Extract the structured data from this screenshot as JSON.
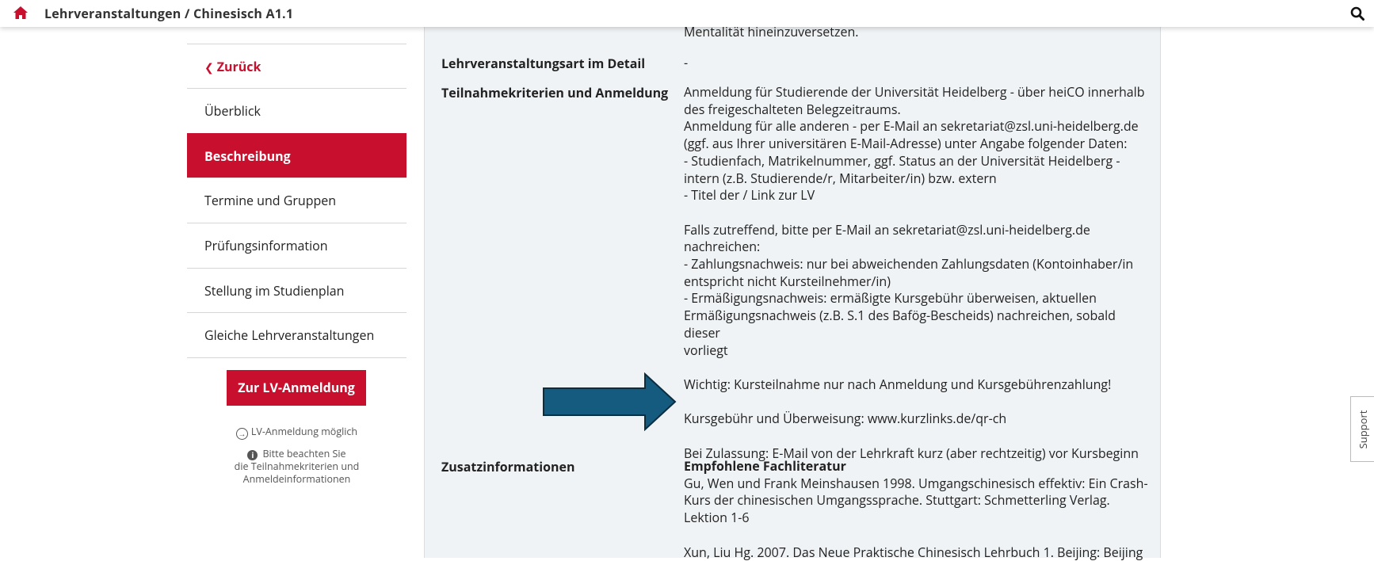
{
  "header": {
    "breadcrumb": "Lehrveranstaltungen / Chinesisch A1.1",
    "home_icon": "home-icon",
    "search_icon": "search-icon",
    "accent": "#c8102e"
  },
  "sidebar": {
    "back_label": "Zurück",
    "items": [
      {
        "label": "Überblick"
      },
      {
        "label": "Beschreibung",
        "active": true
      },
      {
        "label": "Termine und Gruppen"
      },
      {
        "label": "Prüfungsinformation"
      },
      {
        "label": "Stellung im Studienplan"
      },
      {
        "label": "Gleiche Lehrveranstaltungen"
      }
    ],
    "register_button": "Zur LV-Anmeldung",
    "hint_possible": "LV-Anmeldung möglich",
    "hint_note_lines": [
      "Bitte beachten Sie",
      "die Teilnahmekriterien und",
      "Anmeldeinformationen"
    ]
  },
  "content": {
    "cut_text": "Mentalität hineinzuversetzen.",
    "rows": [
      {
        "label": "Lehrveranstaltungsart im Detail",
        "value": "-"
      },
      {
        "label": "Teilnahmekriterien und Anmeldung",
        "lines": [
          "Anmeldung für Studierende der Universität Heidelberg - über heiCO innerhalb",
          "des freigeschalteten Belegzeitraums.",
          "Anmeldung für alle anderen - per E-Mail an sekretariat@zsl.uni-heidelberg.de",
          "(ggf. aus Ihrer universitären E-Mail-Adresse) unter Angabe folgender Daten:",
          "- Studienfach, Matrikelnummer, ggf. Status an der Universität Heidelberg -",
          "intern (z.B. Studierende/r, Mitarbeiter/in) bzw. extern",
          "- Titel der / Link zur LV",
          "",
          "Falls zutreffend, bitte per E-Mail an sekretariat@zsl.uni-heidelberg.de",
          "nachreichen:",
          "- Zahlungsnachweis: nur bei abweichenden Zahlungsdaten (Kontoinhaber/in",
          "entspricht nicht Kursteilnehmer/in)",
          "- Ermäßigungsnachweis: ermäßigte Kursgebühr überweisen, aktuellen",
          "Ermäßigungsnachweis (z.B. S.1 des Bafög-Bescheids) nachreichen, sobald dieser",
          "vorliegt",
          "",
          "Wichtig: Kursteilnahme nur nach Anmeldung und Kursgebührenzahlung!",
          "",
          "Kursgebühr und Überweisung: www.kurzlinks.de/qr-ch",
          "",
          "Bei Zulassung: E-Mail von der Lehrkraft kurz (aber rechtzeitig) vor Kursbeginn"
        ]
      },
      {
        "label": "Zusatzinformationen",
        "heading": "Empfohlene Fachliteratur",
        "lines": [
          "Gu, Wen und Frank Meinshausen 1998. Umgangschinesisch effektiv: Ein Crash-",
          "Kurs der chinesischen Umgangssprache. Stuttgart: Schmetterling Verlag.",
          "Lektion 1-6",
          "",
          "Xun, Liu Hg. 2007. Das Neue Praktische Chinesisch Lehrbuch 1. Beijing: Beijing"
        ]
      }
    ]
  },
  "support_label": "Support"
}
